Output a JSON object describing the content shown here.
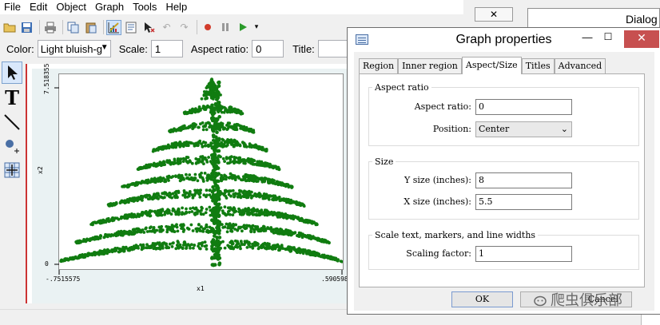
{
  "menu": [
    "File",
    "Edit",
    "Object",
    "Graph",
    "Tools",
    "Help"
  ],
  "toolbar_icons": [
    "open-icon",
    "save-icon",
    "print-icon",
    "copy-icon",
    "paste-icon",
    "graph-editor-icon",
    "properties-icon",
    "cursor-icon",
    "undo-icon",
    "redo-icon",
    "record-icon",
    "pause-icon",
    "play-icon",
    "dropdown-icon"
  ],
  "propbar": {
    "color_label": "Color:",
    "color_value": "Light bluish-g",
    "scale_label": "Scale:",
    "scale_value": "1",
    "aspect_label": "Aspect ratio:",
    "aspect_value": "0",
    "title_label": "Title:",
    "title_value": ""
  },
  "palette": [
    "pointer-tool",
    "text-tool",
    "line-tool",
    "marker-tool",
    "grid-edit-tool"
  ],
  "graph": {
    "ytick_top": "7.518355",
    "ytick_bottom": "0",
    "ylabel": "x2",
    "xtick_left": "-.7515575",
    "xtick_right": ".590598",
    "xlabel": "x1",
    "marker_color": "#107c10"
  },
  "back_window": {
    "close_label": "✕",
    "dialog_title": "Dialog"
  },
  "dialog": {
    "title": "Graph properties",
    "tabs": [
      "Region",
      "Inner region",
      "Aspect/Size",
      "Titles",
      "Advanced"
    ],
    "active_tab": "Aspect/Size",
    "aspect_group": "Aspect ratio",
    "aspect_label": "Aspect ratio:",
    "aspect_value": "0",
    "position_label": "Position:",
    "position_value": "Center",
    "size_group": "Size",
    "ysize_label": "Y size (inches):",
    "ysize_value": "8",
    "xsize_label": "X size (inches):",
    "xsize_value": "5.5",
    "scale_group": "Scale text, markers, and line widths",
    "scaling_label": "Scaling factor:",
    "scaling_value": "1",
    "ok_label": "OK",
    "cancel_label": "Cancel"
  },
  "watermark": "爬虫俱乐部"
}
